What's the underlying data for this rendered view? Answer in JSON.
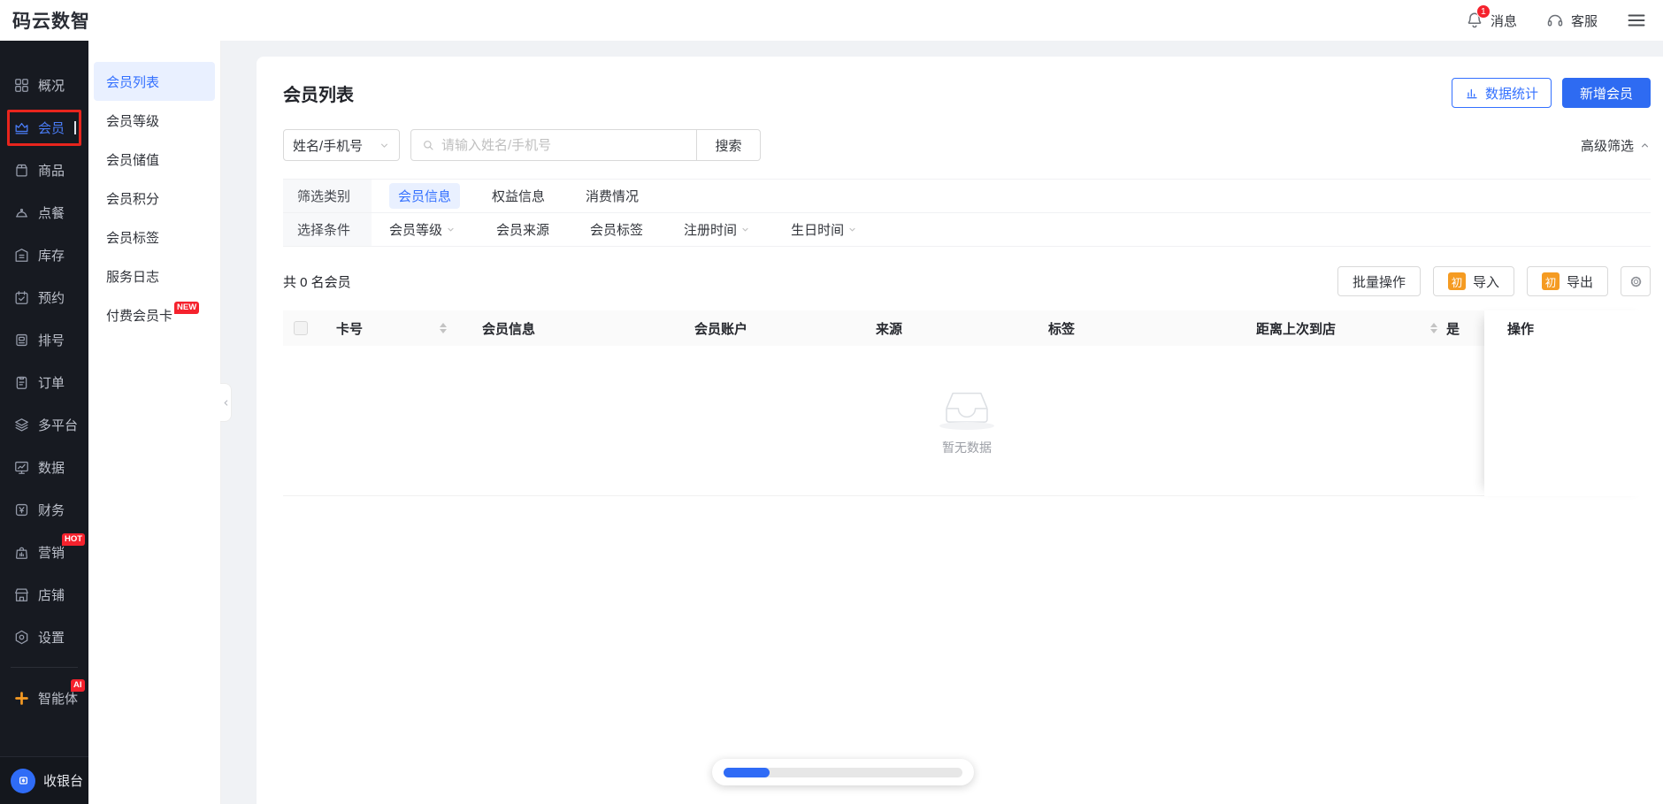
{
  "header": {
    "logo": "码云数智",
    "notification_count": "1",
    "messages_label": "消息",
    "support_label": "客服"
  },
  "sidebar": {
    "items": [
      {
        "label": "概况"
      },
      {
        "label": "会员",
        "active": true
      },
      {
        "label": "商品"
      },
      {
        "label": "点餐"
      },
      {
        "label": "库存"
      },
      {
        "label": "预约"
      },
      {
        "label": "排号"
      },
      {
        "label": "订单"
      },
      {
        "label": "多平台"
      },
      {
        "label": "数据"
      },
      {
        "label": "财务"
      },
      {
        "label": "营销",
        "badge": "HOT"
      },
      {
        "label": "店铺"
      },
      {
        "label": "设置"
      },
      {
        "label": "智能体",
        "badge": "AI"
      }
    ],
    "cashier_label": "收银台"
  },
  "submenu": {
    "items": [
      {
        "label": "会员列表",
        "active": true
      },
      {
        "label": "会员等级"
      },
      {
        "label": "会员储值"
      },
      {
        "label": "会员积分"
      },
      {
        "label": "会员标签"
      },
      {
        "label": "服务日志"
      },
      {
        "label": "付费会员卡",
        "badge": "NEW"
      }
    ]
  },
  "page": {
    "title": "会员列表",
    "actions": {
      "stats": "数据统计",
      "add": "新增会员"
    },
    "search": {
      "field_select": "姓名/手机号",
      "placeholder": "请输入姓名/手机号",
      "button": "搜索",
      "advanced": "高级筛选"
    },
    "filters": {
      "category_label": "筛选类别",
      "categories": [
        {
          "label": "会员信息",
          "active": true
        },
        {
          "label": "权益信息"
        },
        {
          "label": "消费情况"
        }
      ],
      "condition_label": "选择条件",
      "conditions": [
        {
          "label": "会员等级",
          "dropdown": true
        },
        {
          "label": "会员来源"
        },
        {
          "label": "会员标签"
        },
        {
          "label": "注册时间",
          "dropdown": true
        },
        {
          "label": "生日时间",
          "dropdown": true
        }
      ]
    },
    "summary": "共 0 名会员",
    "toolbar": {
      "batch": "批量操作",
      "import": "导入",
      "export": "导出",
      "icon_badge": "初"
    },
    "table": {
      "columns": [
        "卡号",
        "会员信息",
        "会员账户",
        "来源",
        "标签",
        "距离上次到店",
        "是",
        "操作"
      ]
    },
    "empty_text": "暂无数据"
  },
  "colors": {
    "accent": "#3370ff",
    "sidebar_bg": "#171a21",
    "badge_red": "#f5222d",
    "import_orange": "#f59b22",
    "annotation_red": "#e8251d"
  }
}
